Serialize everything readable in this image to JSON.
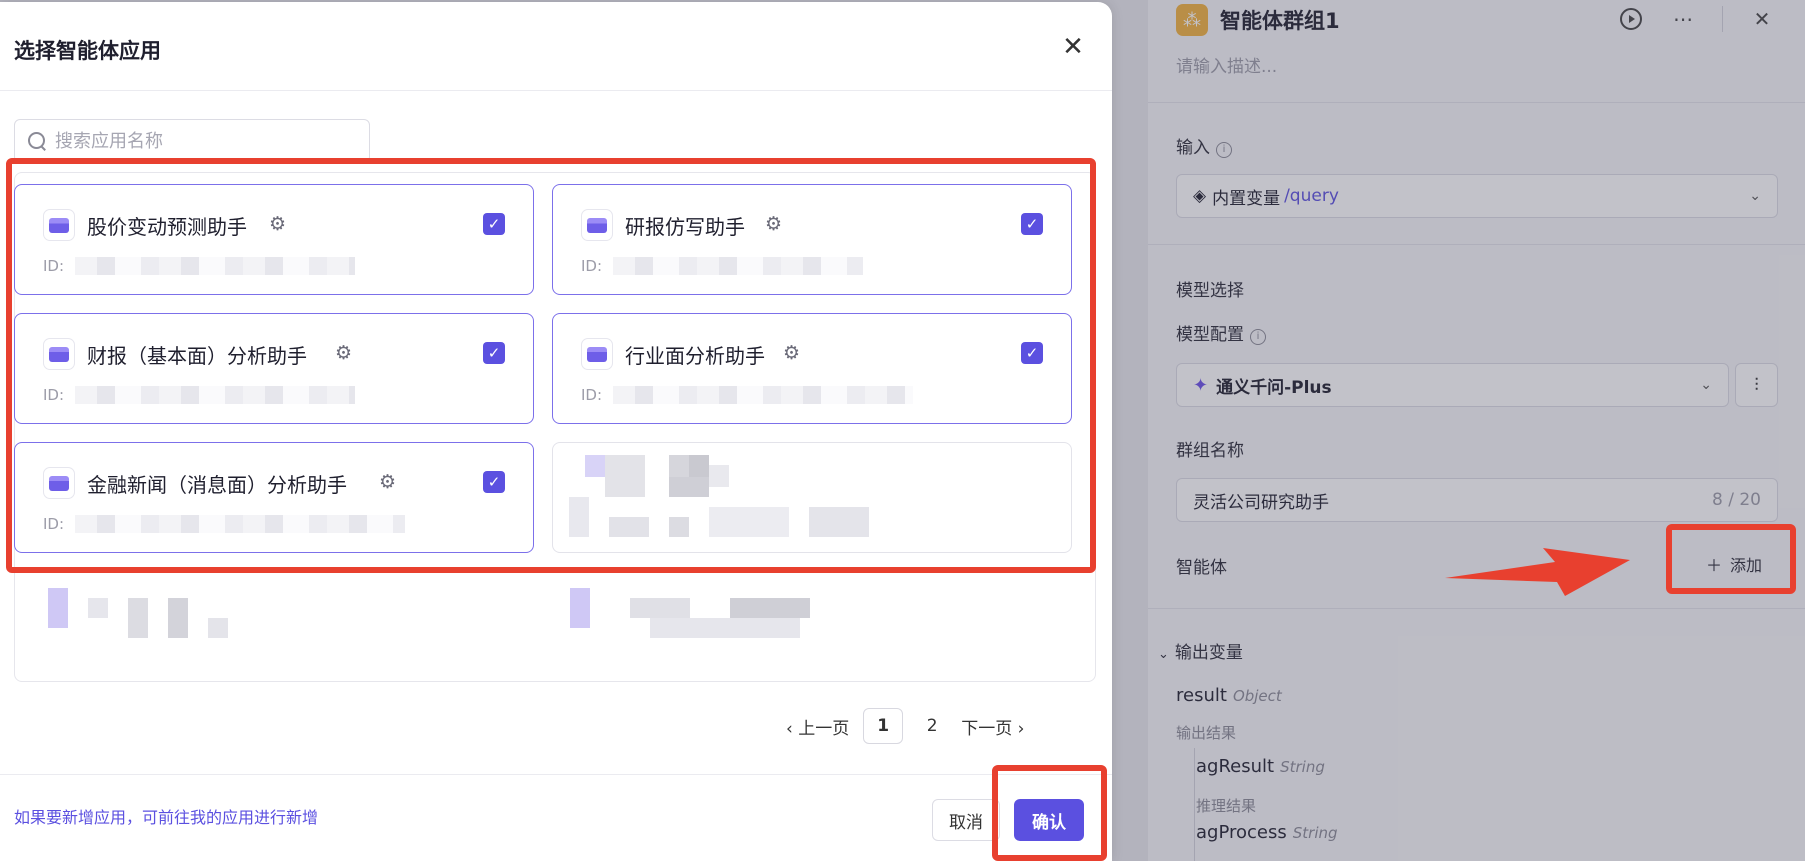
{
  "right_panel": {
    "title": "智能体群组1",
    "description_placeholder": "请输入描述...",
    "input_label": "输入",
    "input_select_prefix": "内置变量",
    "input_select_value": "/query",
    "model_section_label": "模型选择",
    "model_config_label": "模型配置",
    "model_name": "通义千问-Plus",
    "group_name_label": "群组名称",
    "group_name_value": "灵活公司研究助手",
    "group_name_count": "8 / 20",
    "agents_label": "智能体",
    "add_label": "添加",
    "output_section_label": "输出变量",
    "outputs": [
      {
        "name": "result",
        "type": "Object",
        "desc": "输出结果"
      },
      {
        "name": "agResult",
        "type": "String",
        "desc": "推理结果"
      },
      {
        "name": "agProcess",
        "type": "String",
        "desc": ""
      }
    ]
  },
  "modal": {
    "title": "选择智能体应用",
    "search_placeholder": "搜索应用名称",
    "id_label": "ID:",
    "apps": [
      {
        "name": "股价变动预测助手",
        "checked": true
      },
      {
        "name": "研报仿写助手",
        "checked": true
      },
      {
        "name": "财报（基本面）分析助手",
        "checked": true
      },
      {
        "name": "行业面分析助手",
        "checked": true
      },
      {
        "name": "金融新闻（消息面）分析助手",
        "checked": true
      }
    ],
    "pagination": {
      "prev": "上一页",
      "current": "1",
      "next_page_num": "2",
      "next": "下一页"
    },
    "footer_hint_prefix": "如果要新增应用，可前往",
    "footer_hint_link": "我的应用",
    "footer_hint_suffix": "进行新增",
    "cancel_label": "取消",
    "confirm_label": "确认"
  },
  "colors": {
    "accent": "#5b50e0",
    "highlight": "#e8402f"
  }
}
